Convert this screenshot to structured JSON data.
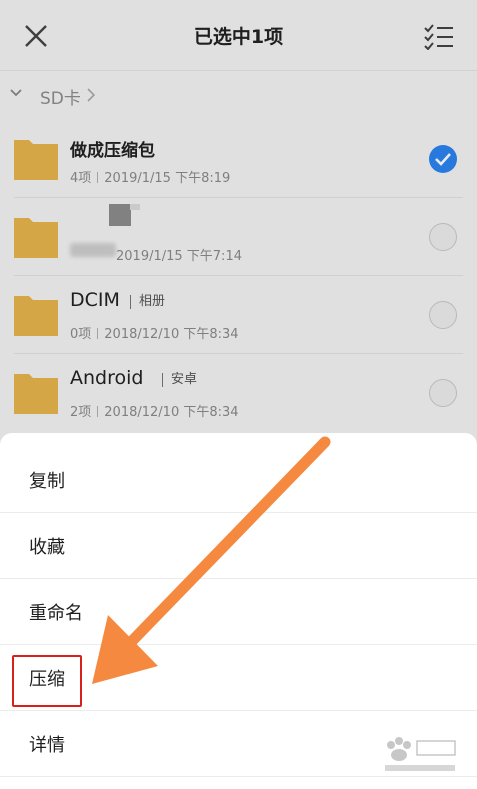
{
  "header": {
    "title": "已选中1项",
    "close_icon": "close-icon",
    "select_all_icon": "checklist-icon"
  },
  "breadcrumb": {
    "label": "SD卡"
  },
  "files": [
    {
      "name": "做成压缩包",
      "count": "4项",
      "date": "2019/1/15 下午8:19",
      "tag": "",
      "selected": true
    },
    {
      "name": "",
      "count": "",
      "date": "2019/1/15 下午7:14",
      "tag": "",
      "selected": false
    },
    {
      "name": "DCIM",
      "count": "0项",
      "date": "2018/12/10 下午8:34",
      "tag": "相册",
      "selected": false
    },
    {
      "name": "Android",
      "count": "2项",
      "date": "2018/12/10 下午8:34",
      "tag": "安卓",
      "selected": false
    }
  ],
  "menu": [
    {
      "label": "复制"
    },
    {
      "label": "收藏"
    },
    {
      "label": "重命名"
    },
    {
      "label": "压缩"
    },
    {
      "label": "详情"
    }
  ],
  "colors": {
    "accent": "#2b84f0",
    "folder": "#e8b54c",
    "highlight": "#d9211c",
    "arrow": "#f5893f"
  }
}
